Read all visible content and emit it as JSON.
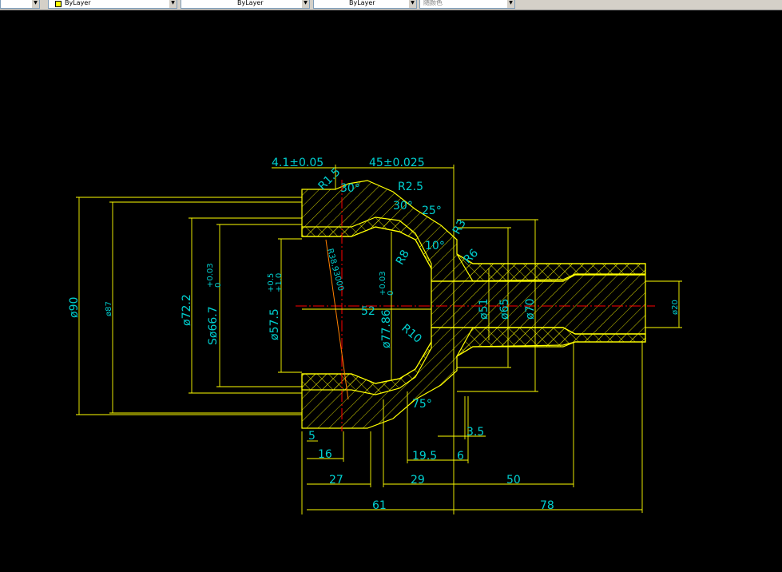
{
  "toolbar": {
    "combo1": "",
    "combo2": "ByLayer",
    "combo3": "ByLayer",
    "combo4": "ByLayer",
    "combo5": "随颜色"
  },
  "colors": {
    "background": "#000000",
    "outline": "#ffff00",
    "hatch": "#ffff00",
    "centerline": "#ff0000",
    "dimension_text": "#00d0d0"
  },
  "dimensions": {
    "d4_1": "4.1±0.05",
    "d45": "45±0.025",
    "r1_5": "R1.5",
    "a30_top": "30°",
    "r2_5": "R2.5",
    "a30_b": "30°",
    "a25": "25°",
    "a10": "10°",
    "r8": "R8",
    "r6": "R6",
    "r3": "R3",
    "r38": "R38.93000",
    "d90": "ø90",
    "d87": "ø87",
    "d72": "ø72.2",
    "tol72_up": "+0.03",
    "tol72_lo": "0",
    "sd66": "Sø66.7",
    "d57": "ø57.5",
    "tol57_up": "+0.5",
    "tol57_lo": "+1.0",
    "d77": "ø77.86",
    "tol77_up": "+0.03",
    "tol77_lo": "0",
    "l52": "52",
    "r10": "R10",
    "d51": "ø51",
    "d65": "ø65",
    "d70": "ø70",
    "d20": "ø20",
    "a75": "75°",
    "l5": "5",
    "l16": "16",
    "l19_5": "19.5",
    "l6": "6",
    "l3_5": "3.5",
    "l27": "27",
    "l29": "29",
    "l50": "50",
    "l61": "61",
    "l78": "78"
  }
}
